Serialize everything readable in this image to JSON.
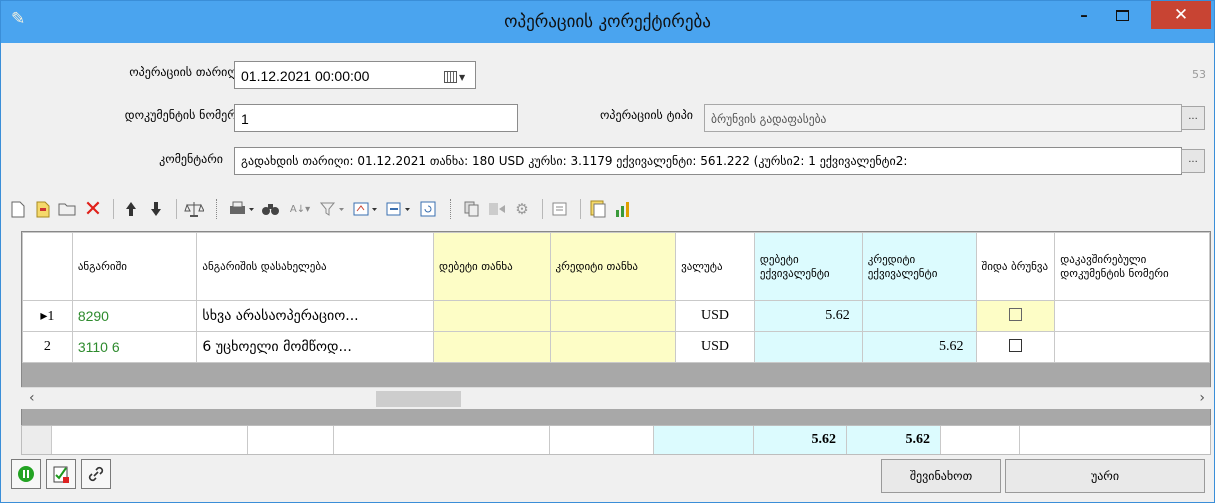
{
  "window": {
    "title": "ოპერაციის კორექტირება",
    "minimize": "–",
    "close": "✕"
  },
  "form": {
    "date_label": "ოპერაციის თარიღი",
    "date_value": "01.12.2021 00:00:00",
    "counter": "53",
    "docnum_label": "დოკუმენტის ნომერი",
    "docnum_value": "1",
    "optype_label": "ოპერაციის ტიპი",
    "optype_value": "ბრუნვის გადაფასება",
    "comment_label": "კომენტარი",
    "comment_value": "გადახდის თარიღი: 01.12.2021 თანხა: 180 USD კურსი: 3.1179 ექვივალენტი: 561.222 (კურსი2: 1 ექვივალენტი2:",
    "dots": "..."
  },
  "grid": {
    "columns": [
      {
        "key": "rowhdr",
        "label": ""
      },
      {
        "key": "account",
        "label": "ანგარიში"
      },
      {
        "key": "account_name",
        "label": "ანგარიშის დასახელება"
      },
      {
        "key": "debit_amount",
        "label": "დებეტი თანხა"
      },
      {
        "key": "credit_amount",
        "label": "კრედიტი თანხა"
      },
      {
        "key": "currency",
        "label": "ვალუტა"
      },
      {
        "key": "debit_equiv",
        "label": "დებეტი ექვივალენტი"
      },
      {
        "key": "credit_equiv",
        "label": "კრედიტი ექვივალენტი"
      },
      {
        "key": "internal_turnover",
        "label": "შიდა ბრუნვა"
      },
      {
        "key": "linked_doc",
        "label": "დაკავშირებული დოკუმენტის ნომერი"
      }
    ],
    "rows": [
      {
        "num": "▸1",
        "account": "8290",
        "account_name": "სხვა არასაოპერაციო...",
        "debit_amount": "",
        "credit_amount": "",
        "currency": "USD",
        "debit_equiv": "5.62",
        "credit_equiv": "",
        "linked_doc": ""
      },
      {
        "num": "2",
        "account": "3110 6",
        "account_name": "6 უცხოელი მომწოდ...",
        "debit_amount": "",
        "credit_amount": "",
        "currency": "USD",
        "debit_equiv": "",
        "credit_equiv": "5.62",
        "linked_doc": ""
      }
    ],
    "totals": {
      "debit_equiv": "5.62",
      "credit_equiv": "5.62"
    }
  },
  "scroll": {
    "left": "‹",
    "right": "›"
  },
  "buttons": {
    "save": "შევინახოთ",
    "cancel": "უარი"
  },
  "colors": {
    "titlebar": "#4aa4ef",
    "close": "#c84433",
    "yellow": "#fdfdc6",
    "cyan": "#dcfbfe",
    "account_green": "#2e8b2e"
  }
}
